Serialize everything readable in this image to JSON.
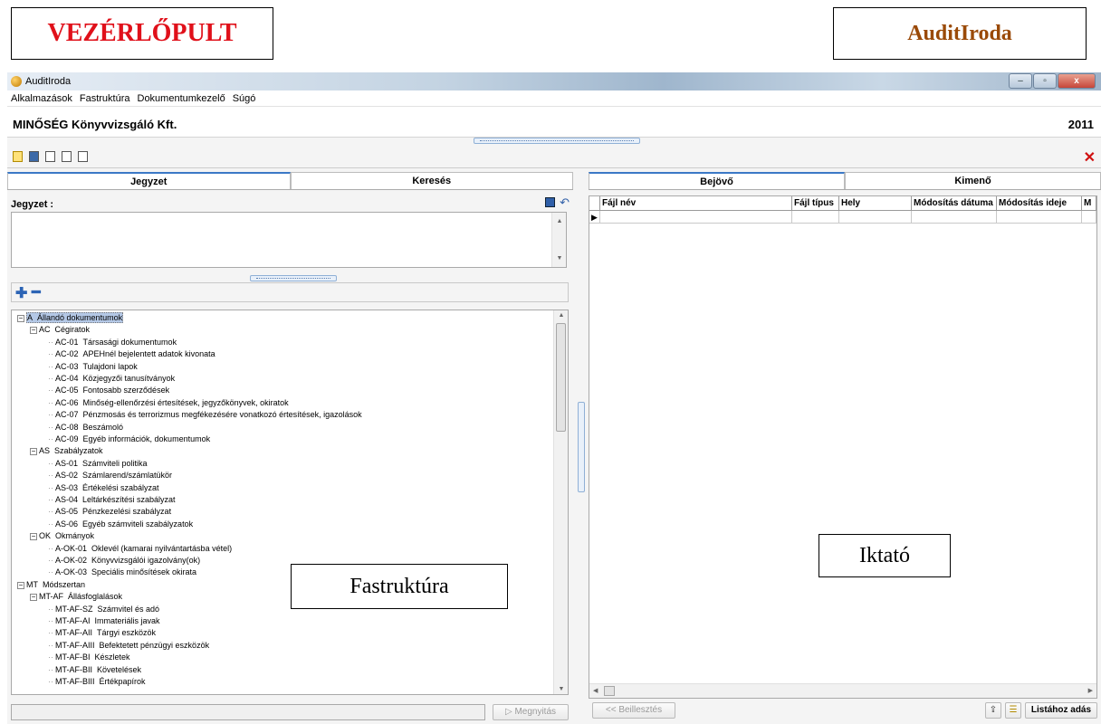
{
  "labels": {
    "left": "VEZÉRLŐPULT",
    "right": "AuditIroda"
  },
  "window": {
    "title": "AuditIroda",
    "icon": "app-logo-icon",
    "buttons": [
      "–",
      "▫",
      "x"
    ]
  },
  "menu": [
    "Alkalmazások",
    "Fastruktúra",
    "Dokumentumkezelő",
    "Súgó"
  ],
  "company": {
    "name": "MINŐSÉG Könyvvizsgáló Kft.",
    "year": "2011"
  },
  "toolbar": {
    "icons": [
      "tree-icon",
      "image-icon",
      "document-icon",
      "copy-icon",
      "paste-icon"
    ],
    "close": "✕"
  },
  "left": {
    "tabs": [
      "Jegyzet",
      "Keresés"
    ],
    "note_label": "Jegyzet :",
    "plus": "✚",
    "minus": "━",
    "open_button": "Megnyitás",
    "tree": [
      {
        "code": "A",
        "name": "Állandó dokumentumok",
        "level": 0,
        "expand": true,
        "selected": true
      },
      {
        "code": "AC",
        "name": "Cégiratok",
        "level": 1,
        "expand": true
      },
      {
        "code": "AC-01",
        "name": "Társasági dokumentumok",
        "level": 2
      },
      {
        "code": "AC-02",
        "name": "APEHnél bejelentett adatok kivonata",
        "level": 2
      },
      {
        "code": "AC-03",
        "name": "Tulajdoni lapok",
        "level": 2
      },
      {
        "code": "AC-04",
        "name": "Közjegyzői tanusítványok",
        "level": 2
      },
      {
        "code": "AC-05",
        "name": "Fontosabb szerződések",
        "level": 2
      },
      {
        "code": "AC-06",
        "name": "Minőség-ellenőrzési értesítések, jegyzőkönyvek, okiratok",
        "level": 2
      },
      {
        "code": "AC-07",
        "name": "Pénzmosás és terrorizmus megfékezésére vonatkozó értesítések, igazolások",
        "level": 2
      },
      {
        "code": "AC-08",
        "name": "Beszámoló",
        "level": 2
      },
      {
        "code": "AC-09",
        "name": "Egyéb információk, dokumentumok",
        "level": 2
      },
      {
        "code": "AS",
        "name": "Szabályzatok",
        "level": 1,
        "expand": true
      },
      {
        "code": "AS-01",
        "name": "Számviteli politika",
        "level": 2
      },
      {
        "code": "AS-02",
        "name": "Számlarend/számlatükör",
        "level": 2
      },
      {
        "code": "AS-03",
        "name": "Értékelési szabályzat",
        "level": 2
      },
      {
        "code": "AS-04",
        "name": "Leltárkészítési szabályzat",
        "level": 2
      },
      {
        "code": "AS-05",
        "name": "Pénzkezelési szabályzat",
        "level": 2
      },
      {
        "code": "AS-06",
        "name": "Egyéb számviteli szabályzatok",
        "level": 2
      },
      {
        "code": "OK",
        "name": "Okmányok",
        "level": 1,
        "expand": true
      },
      {
        "code": "A-OK-01",
        "name": "Oklevél (kamarai nyilvántartásba vétel)",
        "level": 2
      },
      {
        "code": "A-OK-02",
        "name": "Könyvvizsgálói igazolvány(ok)",
        "level": 2
      },
      {
        "code": "A-OK-03",
        "name": "Speciális minősítések okirata",
        "level": 2
      },
      {
        "code": "MT",
        "name": "Módszertan",
        "level": 0,
        "expand": true
      },
      {
        "code": "MT-AF",
        "name": "Állásfoglalások",
        "level": 1,
        "expand": true
      },
      {
        "code": "MT-AF-SZ",
        "name": "Számvitel és adó",
        "level": 2
      },
      {
        "code": "MT-AF-AI",
        "name": "Immateriális javak",
        "level": 2
      },
      {
        "code": "MT-AF-AII",
        "name": "Tárgyi eszközök",
        "level": 2
      },
      {
        "code": "MT-AF-AIII",
        "name": "Befektetett pénzügyi eszközök",
        "level": 2
      },
      {
        "code": "MT-AF-BI",
        "name": "Készletek",
        "level": 2
      },
      {
        "code": "MT-AF-BII",
        "name": "Követelések",
        "level": 2
      },
      {
        "code": "MT-AF-BIII",
        "name": "Értékpapírok",
        "level": 2
      }
    ]
  },
  "right": {
    "tabs": [
      "Bejövő",
      "Kimenő"
    ],
    "columns": [
      "Fájl név",
      "Fájl típus",
      "Hely",
      "Módosítás dátuma",
      "Módosítás ideje",
      "M"
    ],
    "paste_button": "<< Beillesztés",
    "add_button": "Listához adás"
  },
  "overlays": {
    "fastruktura": "Fastruktúra",
    "iktato": "Iktató"
  }
}
